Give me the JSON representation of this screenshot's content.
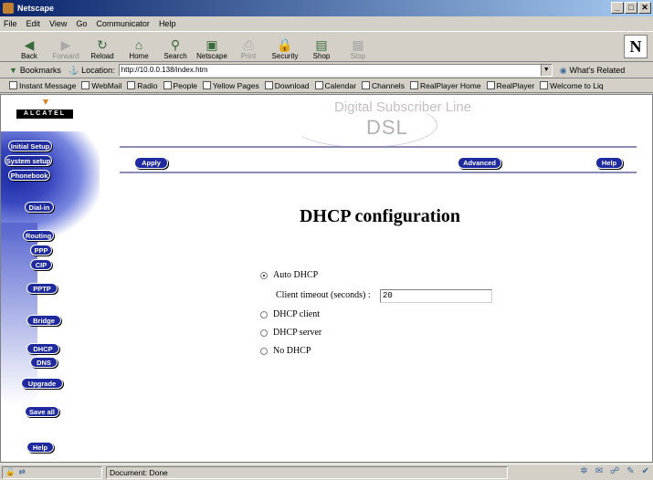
{
  "window": {
    "title": "Netscape"
  },
  "menu": [
    "File",
    "Edit",
    "View",
    "Go",
    "Communicator",
    "Help"
  ],
  "toolbar": [
    {
      "label": "Back",
      "icon": "back-arrow-icon",
      "glyph": "◀",
      "enabled": true
    },
    {
      "label": "Forward",
      "icon": "forward-arrow-icon",
      "glyph": "▶",
      "enabled": false
    },
    {
      "label": "Reload",
      "icon": "reload-icon",
      "glyph": "↻",
      "enabled": true
    },
    {
      "label": "Home",
      "icon": "home-icon",
      "glyph": "⌂",
      "enabled": true
    },
    {
      "label": "Search",
      "icon": "search-icon",
      "glyph": "⚲",
      "enabled": true
    },
    {
      "label": "Netscape",
      "icon": "netscape-icon",
      "glyph": "▣",
      "enabled": true
    },
    {
      "label": "Print",
      "icon": "print-icon",
      "glyph": "⎙",
      "enabled": false
    },
    {
      "label": "Security",
      "icon": "security-lock-icon",
      "glyph": "🔒",
      "enabled": true
    },
    {
      "label": "Shop",
      "icon": "shop-bag-icon",
      "glyph": "▤",
      "enabled": true
    },
    {
      "label": "Stop",
      "icon": "stop-icon",
      "glyph": "▦",
      "enabled": false
    }
  ],
  "locbar": {
    "bookmarks": "Bookmarks",
    "location_label": "Location:",
    "url": "http://10.0.0.138/index.htm",
    "related": "What's Related"
  },
  "links": [
    "Instant Message",
    "WebMail",
    "Radio",
    "People",
    "Yellow Pages",
    "Download",
    "Calendar",
    "Channels",
    "RealPlayer Home",
    "RealPlayer",
    "Welcome to Liq"
  ],
  "brand": {
    "logo": "ALCATEL",
    "product": "Digital Subscriber Line",
    "product_short": "DSL"
  },
  "nav": [
    {
      "label": "Initial Setup",
      "key": "initial-setup"
    },
    {
      "label": "System setup",
      "key": "system-setup"
    },
    {
      "label": "Phonebook",
      "key": "phonebook"
    },
    {
      "label": "Dial-in",
      "key": "dial-in"
    },
    {
      "label": "Routing",
      "key": "routing"
    },
    {
      "label": "PPP",
      "key": "ppp"
    },
    {
      "label": "CIP",
      "key": "cip"
    },
    {
      "label": "PPTP",
      "key": "pptp"
    },
    {
      "label": "Bridge",
      "key": "bridge"
    },
    {
      "label": "DHCP",
      "key": "dhcp"
    },
    {
      "label": "DNS",
      "key": "dns"
    },
    {
      "label": "Upgrade",
      "key": "upgrade"
    },
    {
      "label": "Save all",
      "key": "save-all"
    },
    {
      "label": "Help",
      "key": "help"
    }
  ],
  "actions": {
    "apply": "Apply",
    "advanced": "Advanced",
    "help": "Help"
  },
  "page": {
    "title": "DHCP configuration",
    "options": [
      {
        "label": "Auto DHCP",
        "selected": true
      },
      {
        "label": "DHCP client",
        "selected": false
      },
      {
        "label": "DHCP server",
        "selected": false
      },
      {
        "label": "No DHCP",
        "selected": false
      }
    ],
    "timeout_label": "Client timeout (seconds) :",
    "timeout_value": "20"
  },
  "status": {
    "message": "Document: Done"
  },
  "colors": {
    "accent": "#1e2a9e",
    "titlebar": "#0a246a"
  }
}
